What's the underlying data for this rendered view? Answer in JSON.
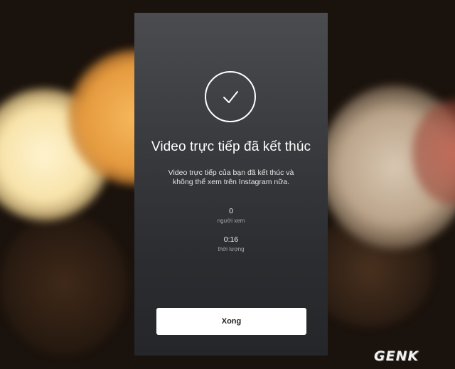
{
  "screen": {
    "title": "Video trực tiếp đã kết thúc",
    "message": "Video trực tiếp của bạn đã kết thúc và không thể xem trên Instagram nữa.",
    "stats": [
      {
        "value": "0",
        "label": "người xem"
      },
      {
        "value": "0:16",
        "label": "thời lượng"
      }
    ],
    "done_label": "Xong",
    "status_icon": "check-circle-icon"
  },
  "watermark": {
    "text": "GENK"
  },
  "colors": {
    "panel_bg": "#3a3c40",
    "button_bg": "#ffffff",
    "text": "#ffffff"
  }
}
